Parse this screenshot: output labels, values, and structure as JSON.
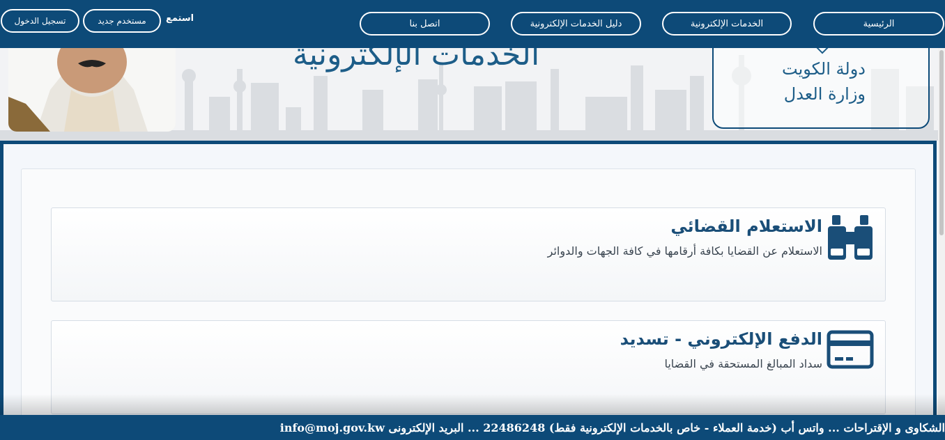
{
  "nav": {
    "home": "الرئيسية",
    "eservices": "الخدمات الإلكترونية",
    "services_guide": "دليل الخدمات الإلكترونية",
    "contact": "اتصل بنا",
    "listen": "استمع",
    "new_user": "مستخدم جديد",
    "login": "تسجيل الدخول"
  },
  "banner": {
    "title": "الخدمات الإلكترونية",
    "logo_line1": "دولة الكويت",
    "logo_line2": "وزارة العدل"
  },
  "cards": [
    {
      "title": "الاستعلام القضائي",
      "description": "الاستعلام عن القضايا بكافة أرقامها في كافة الجهات والدوائر",
      "icon": "binoculars-icon"
    },
    {
      "title": "الدفع الإلكتروني - تسديد",
      "description": "سداد المبالغ المستحقة في القضايا",
      "icon": "credit-card-icon"
    }
  ],
  "ticker": {
    "text": "الشكاوى و الإقتراحات ... واتس أب (خدمة العملاء - خاص بالخدمات الإلكترونية فقط) 22486248 ... البريد الإلكترونى info@moj.gov.kw"
  },
  "colors": {
    "primary": "#0d4a78",
    "title": "#1a4e78"
  }
}
